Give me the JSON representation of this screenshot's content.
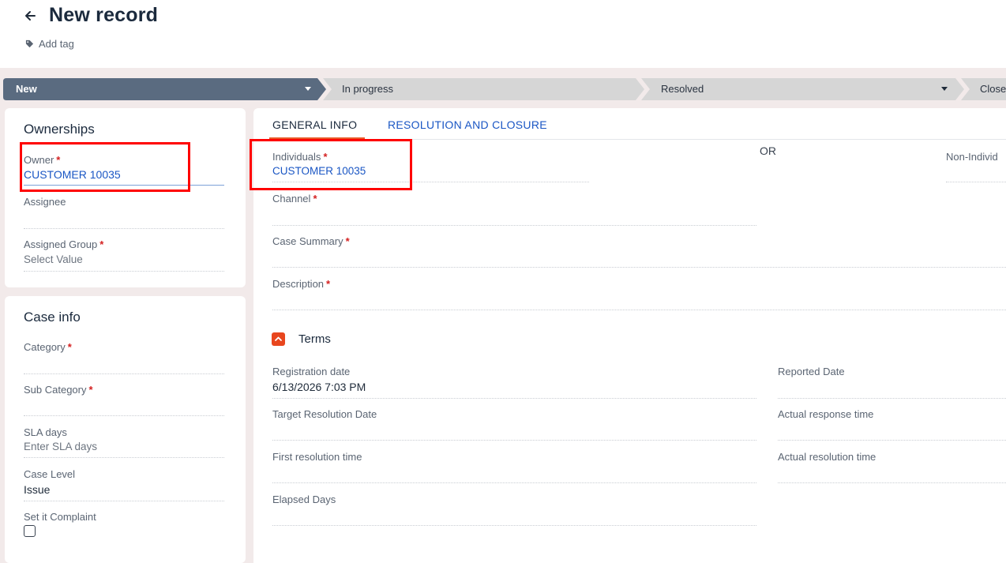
{
  "header": {
    "title": "New record",
    "add_tag": "Add tag"
  },
  "stages": [
    {
      "label": "New",
      "state": "active"
    },
    {
      "label": "In progress",
      "state": "inactive"
    },
    {
      "label": "Resolved",
      "state": "inactive"
    },
    {
      "label": "Close",
      "state": "inactive"
    }
  ],
  "ownerships": {
    "title": "Ownerships",
    "owner_label": "Owner",
    "owner_value": "CUSTOMER 10035",
    "assignee_label": "Assignee",
    "assigned_group_label": "Assigned Group",
    "assigned_group_placeholder": "Select Value"
  },
  "case_info": {
    "title": "Case info",
    "category_label": "Category",
    "sub_category_label": "Sub Category",
    "sla_days_label": "SLA days",
    "sla_days_placeholder": "Enter SLA days",
    "case_level_label": "Case Level",
    "case_level_value": "Issue",
    "complaint_label": "Set it Complaint",
    "complaint_checked": false
  },
  "tabs": [
    {
      "label": "GENERAL INFO",
      "active": true
    },
    {
      "label": "RESOLUTION AND CLOSURE",
      "active": false
    }
  ],
  "general": {
    "individuals_label": "Individuals",
    "individuals_value": "CUSTOMER 10035",
    "or_text": "OR",
    "non_individuals_label": "Non-Individ",
    "channel_label": "Channel",
    "case_summary_label": "Case Summary",
    "description_label": "Description"
  },
  "terms": {
    "title": "Terms",
    "registration_date_label": "Registration date",
    "registration_date_value": "6/13/2026 7:03 PM",
    "reported_date_label": "Reported Date",
    "target_resolution_label": "Target Resolution Date",
    "actual_response_label": "Actual response time",
    "first_resolution_label": "First resolution time",
    "actual_resolution_label": "Actual resolution time",
    "elapsed_days_label": "Elapsed Days"
  },
  "colors": {
    "stage_active": "#5a6b80",
    "stage_inactive": "#d6d6d6",
    "highlight": "#ff0000",
    "accent": "#e8461e",
    "link": "#1a56c4"
  }
}
